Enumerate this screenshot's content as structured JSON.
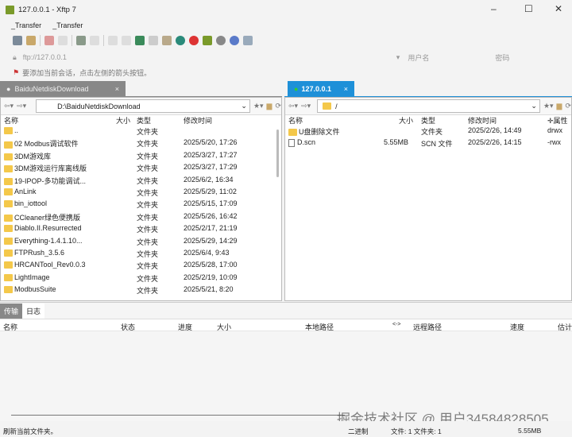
{
  "window": {
    "title": "127.0.0.1 - Xftp 7",
    "minimize": "–",
    "maximize": "☐",
    "close": "✕"
  },
  "menu": [
    "_Transfer",
    "_Transfer"
  ],
  "address": {
    "url": "ftp://127.0.0.1",
    "username_placeholder": "用户名",
    "password_placeholder": "密码"
  },
  "hint": "要添加当前会话，点击左侧的箭头按钮。",
  "left": {
    "tab": "BaiduNetdiskDownload",
    "path": "D:\\BaiduNetdiskDownload",
    "columns": [
      "名称",
      "大小",
      "类型",
      "修改时间"
    ],
    "rows": [
      {
        "name": "..",
        "size": "",
        "type": "文件夹",
        "modified": ""
      },
      {
        "name": "02 Modbus调试软件",
        "size": "",
        "type": "文件夹",
        "modified": "2025/5/20, 17:26"
      },
      {
        "name": "3DM游戏库",
        "size": "",
        "type": "文件夹",
        "modified": "2025/3/27, 17:27"
      },
      {
        "name": "3DM游戏运行库离线版",
        "size": "",
        "type": "文件夹",
        "modified": "2025/3/27, 17:29"
      },
      {
        "name": "19-IPOP-多功能调试...",
        "size": "",
        "type": "文件夹",
        "modified": "2025/6/2, 16:34"
      },
      {
        "name": "AnLink",
        "size": "",
        "type": "文件夹",
        "modified": "2025/5/29, 11:02"
      },
      {
        "name": "bin_iottool",
        "size": "",
        "type": "文件夹",
        "modified": "2025/5/15, 17:09"
      },
      {
        "name": "CCleaner绿色便携版",
        "size": "",
        "type": "文件夹",
        "modified": "2025/5/26, 16:42"
      },
      {
        "name": "Diablo.II.Resurrected",
        "size": "",
        "type": "文件夹",
        "modified": "2025/2/17, 21:19"
      },
      {
        "name": "Everything-1.4.1.10...",
        "size": "",
        "type": "文件夹",
        "modified": "2025/5/29, 14:29"
      },
      {
        "name": "FTPRush_3.5.6",
        "size": "",
        "type": "文件夹",
        "modified": "2025/6/4, 9:43"
      },
      {
        "name": "HRCANTool_Rev0.0.3",
        "size": "",
        "type": "文件夹",
        "modified": "2025/5/28, 17:00"
      },
      {
        "name": "LightImage",
        "size": "",
        "type": "文件夹",
        "modified": "2025/2/19, 10:09"
      },
      {
        "name": "ModbusSuite",
        "size": "",
        "type": "文件夹",
        "modified": "2025/5/21, 8:20"
      }
    ]
  },
  "right": {
    "tab": "127.0.0.1",
    "path": "/",
    "columns": [
      "名称",
      "大小",
      "类型",
      "修改时间",
      "属性"
    ],
    "rows": [
      {
        "name": "U盘删除文件",
        "size": "",
        "type": "文件夹",
        "modified": "2025/2/26, 14:49",
        "attr": "drwx",
        "icon": "folder"
      },
      {
        "name": "D.scn",
        "size": "5.55MB",
        "type": "SCN 文件",
        "modified": "2025/2/26, 14:15",
        "attr": "-rwx",
        "icon": "file"
      }
    ]
  },
  "transfer": {
    "tabs": [
      "传输",
      "日志"
    ],
    "columns": [
      "名称",
      "状态",
      "进度",
      "大小",
      "本地路径",
      "<->",
      "远程路径",
      "速度",
      "估计"
    ]
  },
  "status": {
    "message": "刷新当前文件夹。",
    "mode": "二进制",
    "counts": "文件: 1  文件夹: 1",
    "size": "5.55MB"
  },
  "watermark": "掘金技术社区 @ 用户34584828505"
}
